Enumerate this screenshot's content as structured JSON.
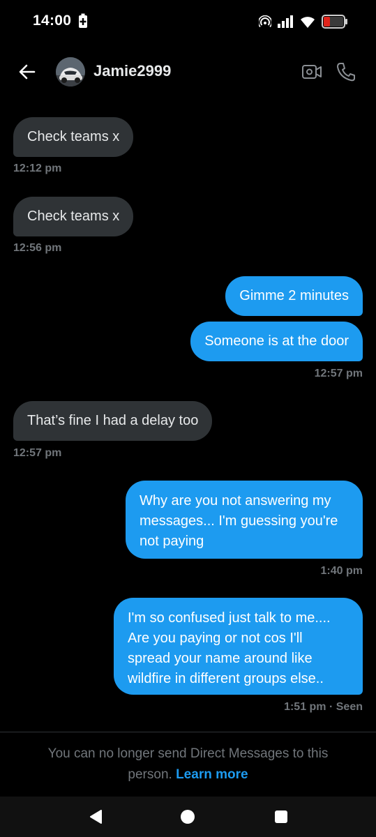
{
  "status": {
    "time": "14:00"
  },
  "header": {
    "name": "Jamie2999",
    "icons": [
      "back-arrow-icon",
      "video-camera-icon",
      "phone-icon"
    ]
  },
  "messages": [
    {
      "side": "in",
      "text": "Check teams x"
    },
    {
      "side": "in",
      "text": "Check teams x"
    },
    {
      "side": "out",
      "text": "Gimme 2 minutes"
    },
    {
      "side": "out",
      "text": "Someone is at the door"
    },
    {
      "side": "in",
      "text": "That’s fine I had a delay too"
    },
    {
      "side": "out",
      "lines": [
        "Why are you not answering my",
        "messages... I'm guessing you're",
        "not paying"
      ]
    },
    {
      "side": "out",
      "lines": [
        "I'm so confused just talk to me....",
        "Are you paying or not cos I'll",
        "spread your name around like",
        "wildfire in different groups else.."
      ]
    }
  ],
  "timestamps": [
    "12:12 pm",
    "12:56 pm",
    "12:57 pm",
    "12:57 pm",
    "1:40 pm",
    "1:51 pm · Seen"
  ],
  "footer": {
    "notice_line1": "You can no longer send Direct Messages to this",
    "notice_line2": "person.",
    "learn_more": "Learn more"
  },
  "colors": {
    "background": "#000000",
    "incoming_bubble": "#2f3336",
    "outgoing_bubble": "#1d9bf0",
    "muted_text": "#71767b",
    "link": "#1d9bf0"
  }
}
